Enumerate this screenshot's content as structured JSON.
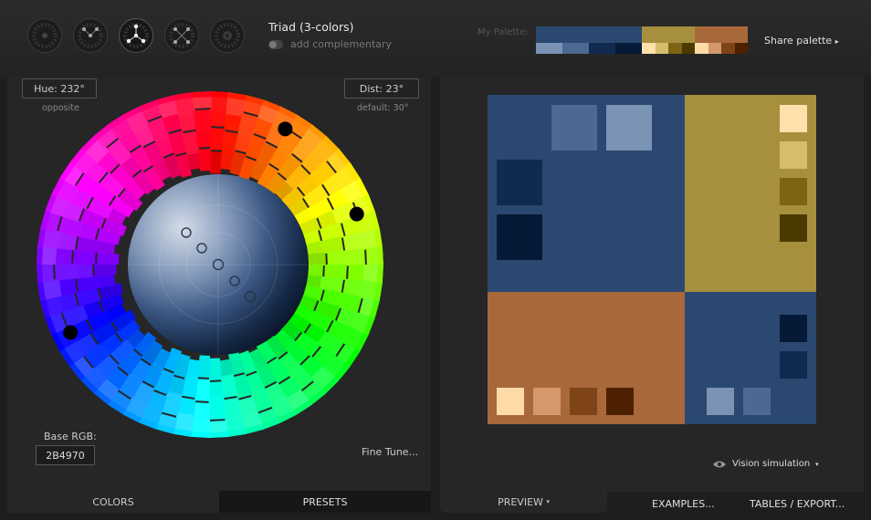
{
  "modes": {
    "title": "Triad (3-colors)",
    "complementary_label": "add complementary",
    "buttons": [
      {
        "name": "mono-mode-icon"
      },
      {
        "name": "complement-mode-icon"
      },
      {
        "name": "triad-mode-icon"
      },
      {
        "name": "tetrad-mode-icon"
      },
      {
        "name": "analogic-mode-icon"
      }
    ]
  },
  "palette": {
    "label": "My Palette:",
    "share_label": "Share palette",
    "groups": [
      {
        "main": "#2B4970",
        "subs": [
          "#7B93B4",
          "#4D6891",
          "#112A4F",
          "#061A37"
        ],
        "flex": 116
      },
      {
        "main": "#A68F3D",
        "subs": [
          "#FFE0AC",
          "#D6BD6E",
          "#7C6414",
          "#4A3A00"
        ],
        "flex": 58
      },
      {
        "main": "#A9683A",
        "subs": [
          "#FFDAA9",
          "#D4986C",
          "#7F4318",
          "#4D2100"
        ],
        "flex": 58
      }
    ]
  },
  "wheel": {
    "hue_label": "Hue: 232°",
    "hue_sublabel": "opposite",
    "dist_label": "Dist: 23°",
    "dist_sublabel": "default: 30°",
    "base_rgb_label": "Base RGB:",
    "base_rgb_value": "2B4970",
    "fine_tune_label": "Fine Tune...",
    "hue_points_deg": [
      29,
      71,
      244
    ]
  },
  "tabs_left": {
    "colors": "COLORS",
    "presets": "PRESETS"
  },
  "tabs_right": {
    "preview": "PREVIEW",
    "examples": "EXAMPLES...",
    "tables": "TABLES / EXPORT..."
  },
  "vision_label": "Vision simulation",
  "colors": {
    "primary": "#2B4970",
    "secondary1": "#A68F3D",
    "secondary2": "#A9683A"
  }
}
